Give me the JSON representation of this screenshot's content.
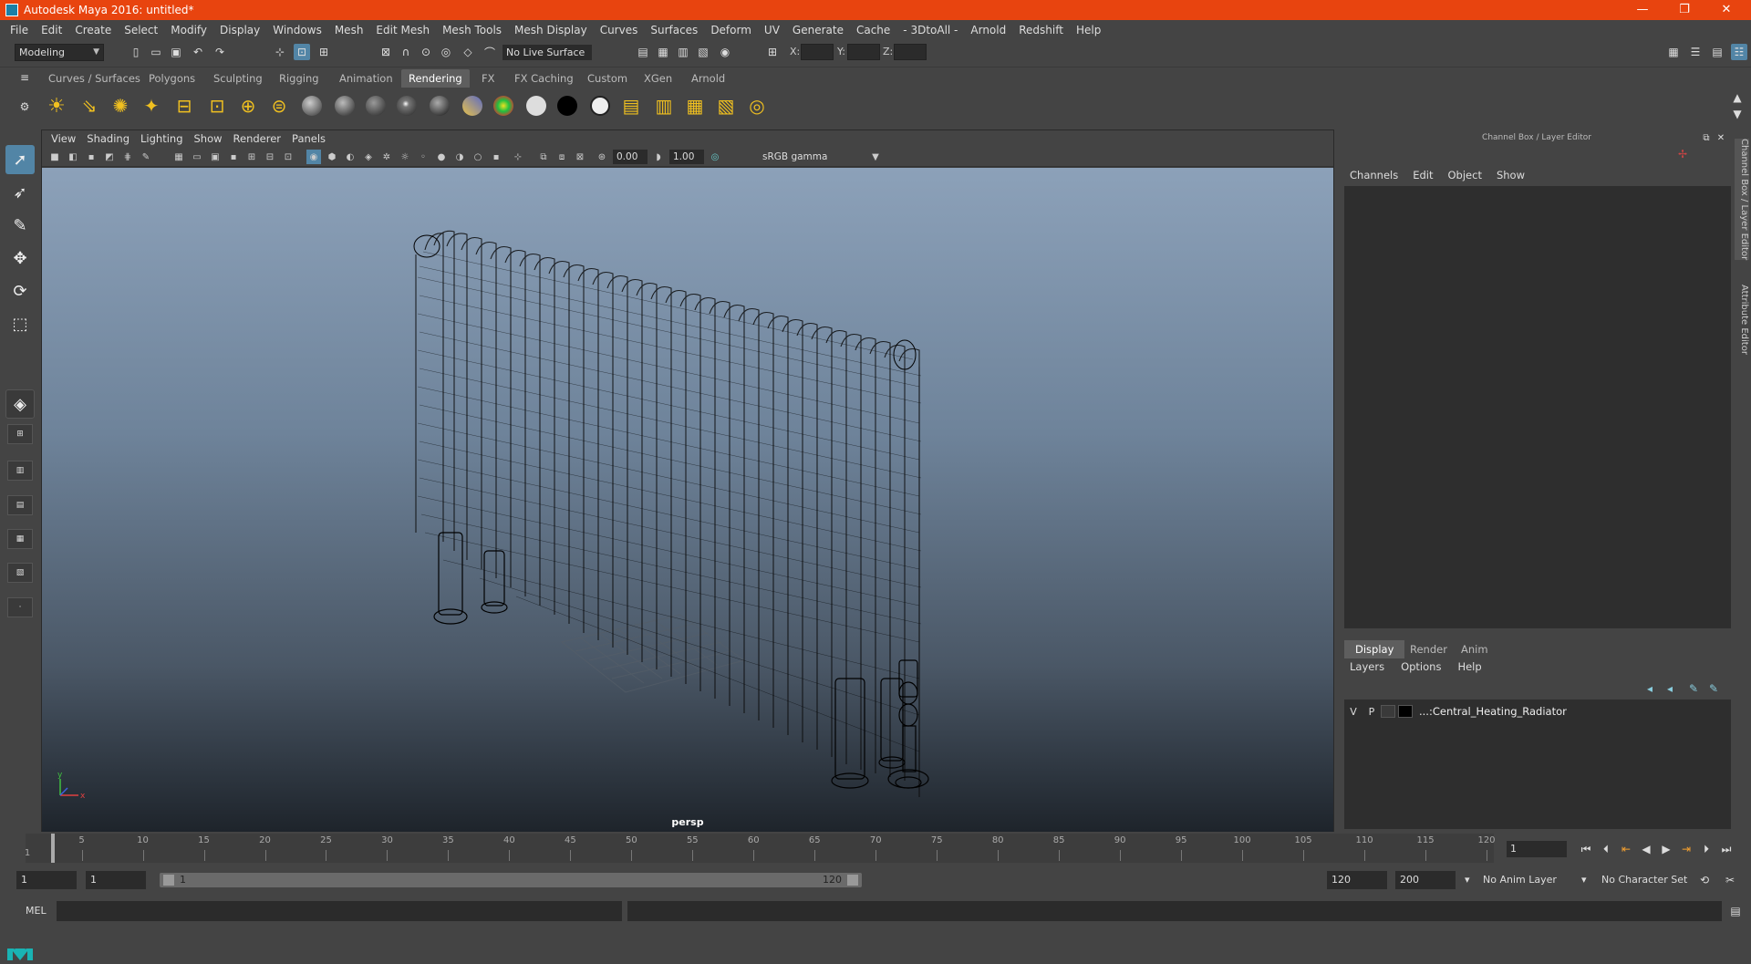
{
  "window": {
    "title": "Autodesk Maya 2016: untitled*"
  },
  "menubar": [
    "File",
    "Edit",
    "Create",
    "Select",
    "Modify",
    "Display",
    "Windows",
    "Mesh",
    "Edit Mesh",
    "Mesh Tools",
    "Mesh Display",
    "Curves",
    "Surfaces",
    "Deform",
    "UV",
    "Generate",
    "Cache",
    "- 3DtoAll -",
    "Arnold",
    "Redshift",
    "Help"
  ],
  "status": {
    "workspace": "Modeling",
    "live_surface": "No Live Surface",
    "x_label": "X:",
    "y_label": "Y:",
    "z_label": "Z:"
  },
  "shelf_tabs": [
    "Curves / Surfaces",
    "Polygons",
    "Sculpting",
    "Rigging",
    "Animation",
    "Rendering",
    "FX",
    "FX Caching",
    "Custom",
    "XGen",
    "Arnold"
  ],
  "shelf_active": "Rendering",
  "viewport": {
    "menu": [
      "View",
      "Shading",
      "Lighting",
      "Show",
      "Renderer",
      "Panels"
    ],
    "exposure": "0.00",
    "gamma": "1.00",
    "color_space": "sRGB gamma",
    "camera_label": "persp",
    "axis_x": "x",
    "axis_y": "y"
  },
  "right_panel": {
    "title": "Channel Box / Layer Editor",
    "menu": [
      "Channels",
      "Edit",
      "Object",
      "Show"
    ],
    "layer_tabs": [
      "Display",
      "Render",
      "Anim"
    ],
    "layer_tab_active": "Display",
    "layer_menu": [
      "Layers",
      "Options",
      "Help"
    ],
    "layer": {
      "v": "V",
      "p": "P",
      "name": "...:Central_Heating_Radiator"
    }
  },
  "side_tabs": [
    "Channel Box / Layer Editor",
    "Attribute Editor"
  ],
  "timeline": {
    "ticks": [
      "5",
      "10",
      "15",
      "20",
      "25",
      "30",
      "35",
      "40",
      "45",
      "50",
      "55",
      "60",
      "65",
      "70",
      "75",
      "80",
      "85",
      "90",
      "95",
      "100",
      "105",
      "110",
      "115",
      "120"
    ],
    "start": "1",
    "current_frame": "1"
  },
  "range": {
    "start": "1",
    "current": "1",
    "slider_start": "1",
    "slider_end": "120",
    "end": "120",
    "max": "200",
    "anim_layer": "No Anim Layer",
    "character_set": "No Character Set"
  },
  "cmdline": {
    "label": "MEL"
  }
}
